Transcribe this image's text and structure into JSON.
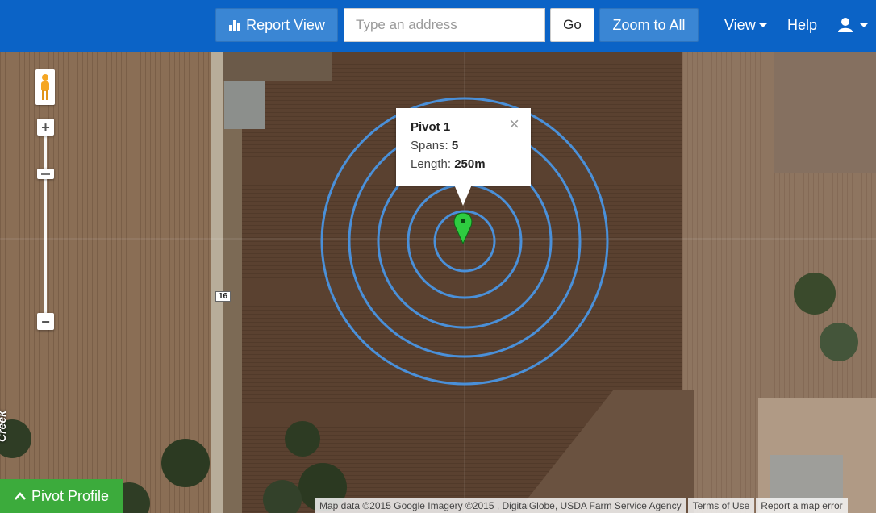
{
  "toolbar": {
    "report_view_label": "Report View",
    "address_placeholder": "Type an address",
    "address_value": "",
    "go_label": "Go",
    "zoom_all_label": "Zoom to All",
    "view_label": "View",
    "help_label": "Help"
  },
  "map": {
    "zoom_in_label": "+",
    "zoom_out_label": "−",
    "road_shield": "16",
    "creek_label": "Creek",
    "pivot_ring_color": "#4a90d9",
    "marker_color": "#2ecc40"
  },
  "info_window": {
    "title": "Pivot 1",
    "spans_label": "Spans:",
    "spans_value": "5",
    "length_label": "Length:",
    "length_value": "250m",
    "close_label": "×"
  },
  "pivot_profile": {
    "label": "Pivot Profile"
  },
  "attribution": {
    "map_data": "Map data ©2015 Google Imagery ©2015 , DigitalGlobe, USDA Farm Service Agency",
    "terms": "Terms of Use",
    "report_error": "Report a map error"
  },
  "colors": {
    "topbar": "#0b63c6",
    "button": "#3a86d4",
    "pivot_profile": "#3cab3c"
  }
}
